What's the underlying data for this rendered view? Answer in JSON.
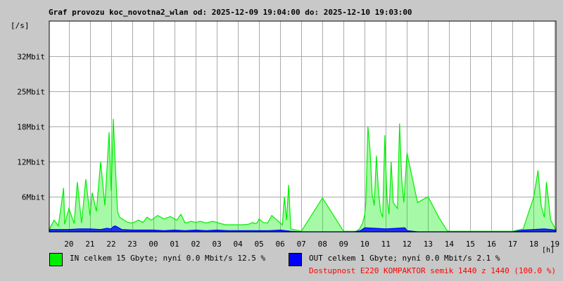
{
  "title": "Graf provozu koc_novotna2_wlan od: 2025-12-09 19:04:00 do: 2025-12-10 19:03:00",
  "colors": {
    "in": "#00ee00",
    "out": "#0000ff",
    "grid": "#aaaaaa",
    "plot_bg": "#ffffff",
    "page_bg": "#c8c8c8",
    "availability": "#ff0000"
  },
  "chart_data": {
    "type": "area",
    "ylabel": "[/s]",
    "xunit": "[h]",
    "y_ticks": [
      {
        "label": "6Mbit",
        "value": 6
      },
      {
        "label": "12Mbit",
        "value": 12
      },
      {
        "label": "18Mbit",
        "value": 18
      },
      {
        "label": "25Mbit",
        "value": 24
      },
      {
        "label": "32Mbit",
        "value": 30
      }
    ],
    "ylim": [
      0,
      36
    ],
    "x_ticks": [
      "20",
      "21",
      "22",
      "23",
      "00",
      "01",
      "02",
      "03",
      "04",
      "05",
      "06",
      "07",
      "08",
      "09",
      "10",
      "11",
      "12",
      "13",
      "14",
      "15",
      "16",
      "17",
      "18",
      "19"
    ],
    "xlim_hours": [
      19.07,
      43.05
    ],
    "grid": true,
    "series": [
      {
        "name": "IN",
        "x": [
          19.07,
          19.3,
          19.5,
          19.75,
          19.8,
          20.0,
          20.25,
          20.4,
          20.6,
          20.8,
          21.0,
          21.1,
          21.3,
          21.5,
          21.7,
          21.9,
          22.0,
          22.1,
          22.2,
          22.3,
          22.4,
          22.6,
          22.8,
          23.0,
          23.3,
          23.5,
          23.7,
          23.9,
          24.2,
          24.5,
          24.8,
          25.1,
          25.3,
          25.5,
          25.8,
          26.0,
          26.2,
          26.5,
          26.8,
          27.1,
          27.4,
          27.8,
          28.2,
          28.5,
          28.7,
          28.8,
          28.9,
          29.0,
          29.2,
          29.4,
          29.6,
          30.1,
          30.2,
          30.3,
          30.4,
          30.5,
          31.0,
          32.0,
          33.0,
          33.5,
          33.6,
          33.75,
          33.9,
          34.0,
          34.05,
          34.15,
          34.25,
          34.35,
          34.45,
          34.55,
          34.65,
          34.75,
          34.85,
          34.95,
          35.05,
          35.15,
          35.25,
          35.35,
          35.45,
          35.55,
          35.65,
          35.75,
          35.85,
          36.0,
          36.5,
          37.0,
          37.5,
          37.9,
          38.0,
          38.1,
          38.2,
          38.3,
          38.4,
          38.5,
          38.6,
          38.8,
          38.95,
          39.1,
          39.25,
          39.4,
          39.5,
          39.6,
          39.7,
          39.8,
          40.0,
          41.0,
          41.5,
          42.0,
          42.2,
          42.35,
          42.5,
          42.6,
          42.8,
          43.05
        ],
        "values": [
          0.4,
          2.0,
          1.0,
          7.5,
          1.3,
          4.0,
          1.4,
          8.5,
          1.5,
          9.0,
          2.8,
          6.7,
          3.5,
          12.0,
          4.5,
          17.0,
          7.0,
          19.3,
          11.0,
          3.5,
          2.5,
          2.0,
          1.6,
          1.5,
          2.0,
          1.6,
          2.5,
          2.0,
          2.8,
          2.2,
          2.6,
          2.0,
          3.0,
          1.5,
          1.8,
          1.6,
          1.8,
          1.5,
          1.8,
          1.5,
          1.2,
          1.2,
          1.2,
          1.3,
          1.6,
          1.4,
          1.5,
          2.2,
          1.6,
          1.5,
          2.8,
          1.2,
          6.0,
          2.0,
          8.0,
          0.5,
          0.1,
          5.8,
          0.1,
          0.1,
          0.1,
          0.5,
          1.5,
          3.0,
          5.0,
          18.0,
          14.0,
          6.5,
          4.5,
          13.0,
          7.0,
          3.5,
          2.5,
          16.5,
          6.0,
          3.0,
          12.0,
          5.0,
          4.5,
          4.0,
          18.5,
          9.0,
          5.0,
          13.5,
          5.0,
          6.0,
          2.5,
          0.2,
          0.1,
          0.1,
          0.1,
          0.1,
          0.1,
          0.1,
          0.1,
          0.1,
          0.1,
          0.1,
          0.1,
          0.1,
          0.1,
          0.1,
          0.1,
          0.1,
          0.1,
          0.1,
          0.5,
          6.0,
          10.5,
          4.5,
          2.5,
          8.5,
          2.0,
          0.3
        ]
      },
      {
        "name": "OUT",
        "x": [
          19.07,
          20.0,
          20.5,
          21.0,
          21.5,
          21.8,
          22.0,
          22.1,
          22.2,
          22.5,
          23.0,
          23.5,
          24.0,
          24.5,
          25.0,
          25.5,
          26.0,
          26.5,
          27.0,
          27.5,
          28.0,
          28.5,
          29.0,
          29.5,
          30.0,
          30.5,
          31.0,
          32.0,
          33.0,
          33.5,
          33.8,
          34.0,
          34.5,
          35.0,
          35.5,
          35.9,
          36.0,
          36.5,
          37.0,
          37.5,
          38.0,
          38.5,
          39.0,
          39.5,
          40.0,
          41.0,
          41.5,
          42.0,
          42.5,
          43.05
        ],
        "values": [
          0.4,
          0.4,
          0.5,
          0.5,
          0.4,
          0.6,
          0.5,
          0.9,
          1.0,
          0.4,
          0.3,
          0.3,
          0.3,
          0.2,
          0.3,
          0.2,
          0.3,
          0.2,
          0.3,
          0.2,
          0.2,
          0.2,
          0.2,
          0.2,
          0.3,
          0.1,
          0.0,
          0.0,
          0.0,
          0.0,
          0.2,
          0.7,
          0.6,
          0.5,
          0.6,
          0.7,
          0.2,
          0.0,
          0.0,
          0.0,
          0.0,
          0.0,
          0.0,
          0.0,
          0.0,
          0.0,
          0.3,
          0.4,
          0.5,
          0.3
        ]
      }
    ]
  },
  "legend": {
    "in_text": "IN celkem 15 Gbyte; nyní   0.0 Mbit/s 12.5 %",
    "out_text": "OUT celkem 1 Gbyte; nyní   0.0 Mbit/s 2.1 %"
  },
  "availability_text": "Dostupnost E220 KOMPAKTOR semik 1440 z 1440 (100.0 %)"
}
